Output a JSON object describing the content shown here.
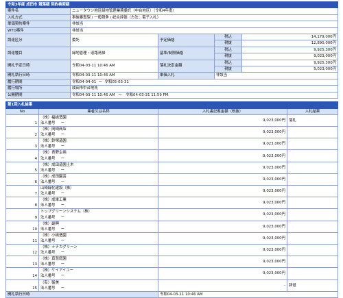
{
  "header": {
    "title": "令和3年度 成田市 競落額 契約検索額"
  },
  "fields": {
    "project_name": {
      "label": "案件名",
      "value": "ニュータウン地区緑地管理業務委託（中台地区）（令和4年度）"
    },
    "bid_method": {
      "label": "入札方式",
      "value": "事後審査型 / 一般競争 / 総合評価（方法：電子入札）"
    },
    "sanction": {
      "label": "単価契約案件",
      "value": "非該当"
    },
    "wto": {
      "label": "WTO案件",
      "value": "非該当"
    },
    "category": {
      "label": "調達区分",
      "value": "委託"
    },
    "type": {
      "label": "調達種目",
      "value": "緑地管理・道路清掃"
    },
    "open_date": {
      "label": "開札予定日時",
      "value": "令和04-03-11 10:46 AM"
    },
    "exec_date": {
      "label": "開札執行日時",
      "value": "令和04-03-11 10:46 AM"
    },
    "period": {
      "label": "履行期間",
      "from": "令和04-04-01",
      "sep": "〜",
      "to": "令和05-03-31"
    },
    "place": {
      "label": "履行場所",
      "value": "成田市中台地先"
    },
    "public": {
      "label": "公開期間",
      "from": "令和04-03-11 10:46 AM",
      "sep": "〜",
      "to": "令和04-03-31 11:59 PM"
    }
  },
  "right": {
    "planned_price": {
      "label": "予定価格",
      "rows": [
        {
          "tax": "税込",
          "amount": "14,179,000円"
        },
        {
          "tax": "税抜",
          "amount": "12,890,000円"
        }
      ]
    },
    "min_price": {
      "label": "基準/制限価格",
      "rows": [
        {
          "tax": "税込",
          "amount": "9,925,300円"
        },
        {
          "tax": "税抜",
          "amount": "9,023,000円"
        }
      ]
    },
    "award": {
      "label": "落札決定金額",
      "rows": [
        {
          "tax": "税込",
          "amount": "9,925,300円"
        },
        {
          "tax": "税抜",
          "amount": "9,023,000円"
        }
      ]
    },
    "unit": {
      "label": "単価入札",
      "value": "非該当"
    }
  },
  "results": {
    "title": "第1回入札結果",
    "columns": {
      "no": "No",
      "name": "業者又は名称",
      "amount": "入札書記載金額（税抜）",
      "result": "入札結果"
    },
    "corp_label": "法人番号",
    "corp_dash": "ー",
    "bidders": [
      {
        "no": "1",
        "name": "（株）福嶋造園",
        "amount": "9,023,000円",
        "result": "落札"
      },
      {
        "no": "2",
        "name": "（株）岡崎商店",
        "amount": "9,023,000円",
        "result": ""
      },
      {
        "no": "3",
        "name": "（株）鈴塚造園",
        "amount": "9,023,000円",
        "result": ""
      },
      {
        "no": "4",
        "name": "（株）青野企画",
        "amount": "9,023,000円",
        "result": ""
      },
      {
        "no": "5",
        "name": "（株）成田造園土木",
        "amount": "9,023,000円",
        "result": ""
      },
      {
        "no": "6",
        "name": "（株）成田園芸",
        "amount": "9,023,000円",
        "result": ""
      },
      {
        "no": "7",
        "name": "山崎緑化建設（株）",
        "amount": "9,023,000円",
        "result": ""
      },
      {
        "no": "8",
        "name": "（株）成単工業",
        "amount": "9,023,000円",
        "result": ""
      },
      {
        "no": "9",
        "name": "トップグリーンシステム（株）",
        "amount": "9,023,000円",
        "result": ""
      },
      {
        "no": "10",
        "name": "（株）副興",
        "amount": "9,023,000円",
        "result": ""
      },
      {
        "no": "11",
        "name": "（株）小嶋造園",
        "amount": "9,023,000円",
        "result": ""
      },
      {
        "no": "12",
        "name": "（株）ナチカグリーン",
        "amount": "9,023,000円",
        "result": ""
      },
      {
        "no": "13",
        "name": "（株）真慧庭園",
        "amount": "9,023,000円",
        "result": ""
      },
      {
        "no": "14",
        "name": "（株）ケイアイユー",
        "amount": "9,023,000円",
        "result": ""
      },
      {
        "no": "15",
        "name": "（有）猛美",
        "amount": "-",
        "result": "辞退"
      }
    ],
    "footer": {
      "label": "開札執行日時",
      "value": "令和04-03-11 10:46 AM"
    }
  }
}
